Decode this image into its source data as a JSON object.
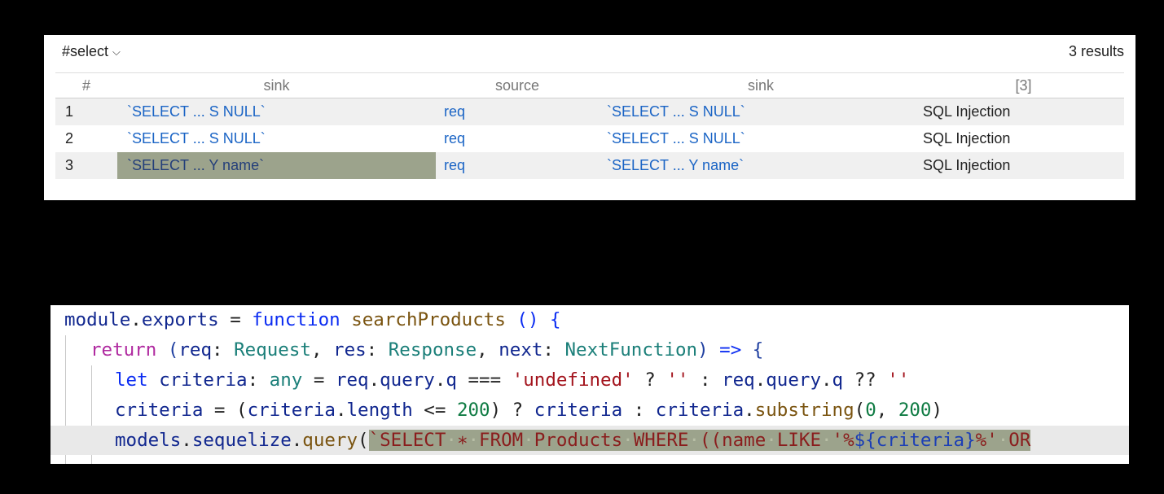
{
  "results_panel": {
    "query_name": "#select",
    "result_count": "3 results",
    "columns": [
      "#",
      "sink",
      "source",
      "sink",
      "[3]"
    ],
    "rows": [
      {
        "num": "1",
        "sink": "`SELECT ... S NULL`",
        "source": "req",
        "sink2": "`SELECT ... S NULL`",
        "message": "SQL Injection"
      },
      {
        "num": "2",
        "sink": "`SELECT ... S NULL`",
        "source": "req",
        "sink2": "`SELECT ... S NULL`",
        "message": "SQL Injection"
      },
      {
        "num": "3",
        "sink": "`SELECT ... Y name`",
        "source": "req",
        "sink2": "`SELECT ... Y name`",
        "message": "SQL Injection"
      }
    ],
    "selected_row": 3,
    "highlight_color": "#9ca38c",
    "link_color": "#1a64c5"
  },
  "code": {
    "l1": {
      "a": "module",
      "b": ".",
      "c": "exports",
      "d": " = ",
      "e": "function",
      "f": " ",
      "g": "searchProducts",
      "h": " () {"
    },
    "l2": {
      "a": "return",
      "b": " (",
      "c": "req",
      "d": ": ",
      "e": "Request",
      "f": ", ",
      "g": "res",
      "h": ": ",
      "i": "Response",
      "j": ", ",
      "k": "next",
      "l": ": ",
      "m": "NextFunction",
      "n": ") ",
      "o": "=>",
      "p": " {"
    },
    "l3": {
      "a": "let",
      "b": " ",
      "c": "criteria",
      "d": ": ",
      "e": "any",
      "f": " = ",
      "g": "req",
      "h": ".",
      "i": "query",
      "j": ".",
      "k": "q",
      "l": " === ",
      "m": "'undefined'",
      "n": " ? ",
      "o": "''",
      "p": " : ",
      "q": "req",
      "r": ".",
      "s": "query",
      "t": ".",
      "u": "q",
      "v": " ?? ",
      "w": "''"
    },
    "l4": {
      "a": "criteria",
      "b": " = (",
      "c": "criteria",
      "d": ".",
      "e": "length",
      "f": " <= ",
      "g": "200",
      "h": ") ? ",
      "i": "criteria",
      "j": " : ",
      "k": "criteria",
      "l": ".",
      "m": "substring",
      "n": "(",
      "o": "0",
      "p": ", ",
      "q": "200",
      "r": ")"
    },
    "l5": {
      "a": "models",
      "b": ".",
      "c": "sequelize",
      "d": ".",
      "e": "query",
      "f": "(",
      "g1": "`SELECT",
      "g2": "·",
      "g3": "∗",
      "g4": "·",
      "g5": "FROM",
      "g6": "·",
      "g7": "Products",
      "g8": "·",
      "g9": "WHERE",
      "g10": "·",
      "g11": "((name",
      "g12": "·",
      "g13": "LIKE",
      "g14": "·",
      "g15": "'%",
      "g16": "${criteria}",
      "g17": "%'",
      "g18": "·",
      "g19": "OR"
    }
  }
}
